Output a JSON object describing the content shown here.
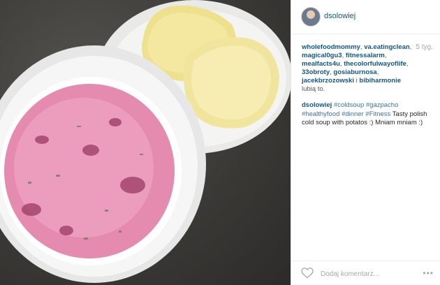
{
  "post": {
    "username": "dsolowiej",
    "time_ago": "5 tyg.",
    "photo_alt": "Photo of pink cold beet soup in a white bowl next to boiled potatoes on a plate",
    "likes": {
      "users": [
        "wholefoodmommy",
        "va.eatingclean",
        "magical0gu3",
        "fitnessalarm",
        "mealfacts4u",
        "thecolorfulwayoflife",
        "33obroty",
        "gosiaburnosa",
        "jacekbrzozowski",
        "bibiharmonie"
      ],
      "connector": "i",
      "suffix": "lubią to."
    },
    "caption": {
      "author": "dsolowiej",
      "hashtags": [
        "#coldsoup",
        "#gazpacho",
        "#healthyfood",
        "#dinner",
        "#Fitness"
      ],
      "text": "Tasty polish cold soup with potatos :) Mniam mniam :)"
    }
  },
  "footer": {
    "comment_placeholder": "Dodaj komentarz...",
    "more_label": "•••"
  },
  "icons": {
    "avatar": "user-avatar",
    "like": "heart-icon",
    "more": "more-options-icon"
  }
}
